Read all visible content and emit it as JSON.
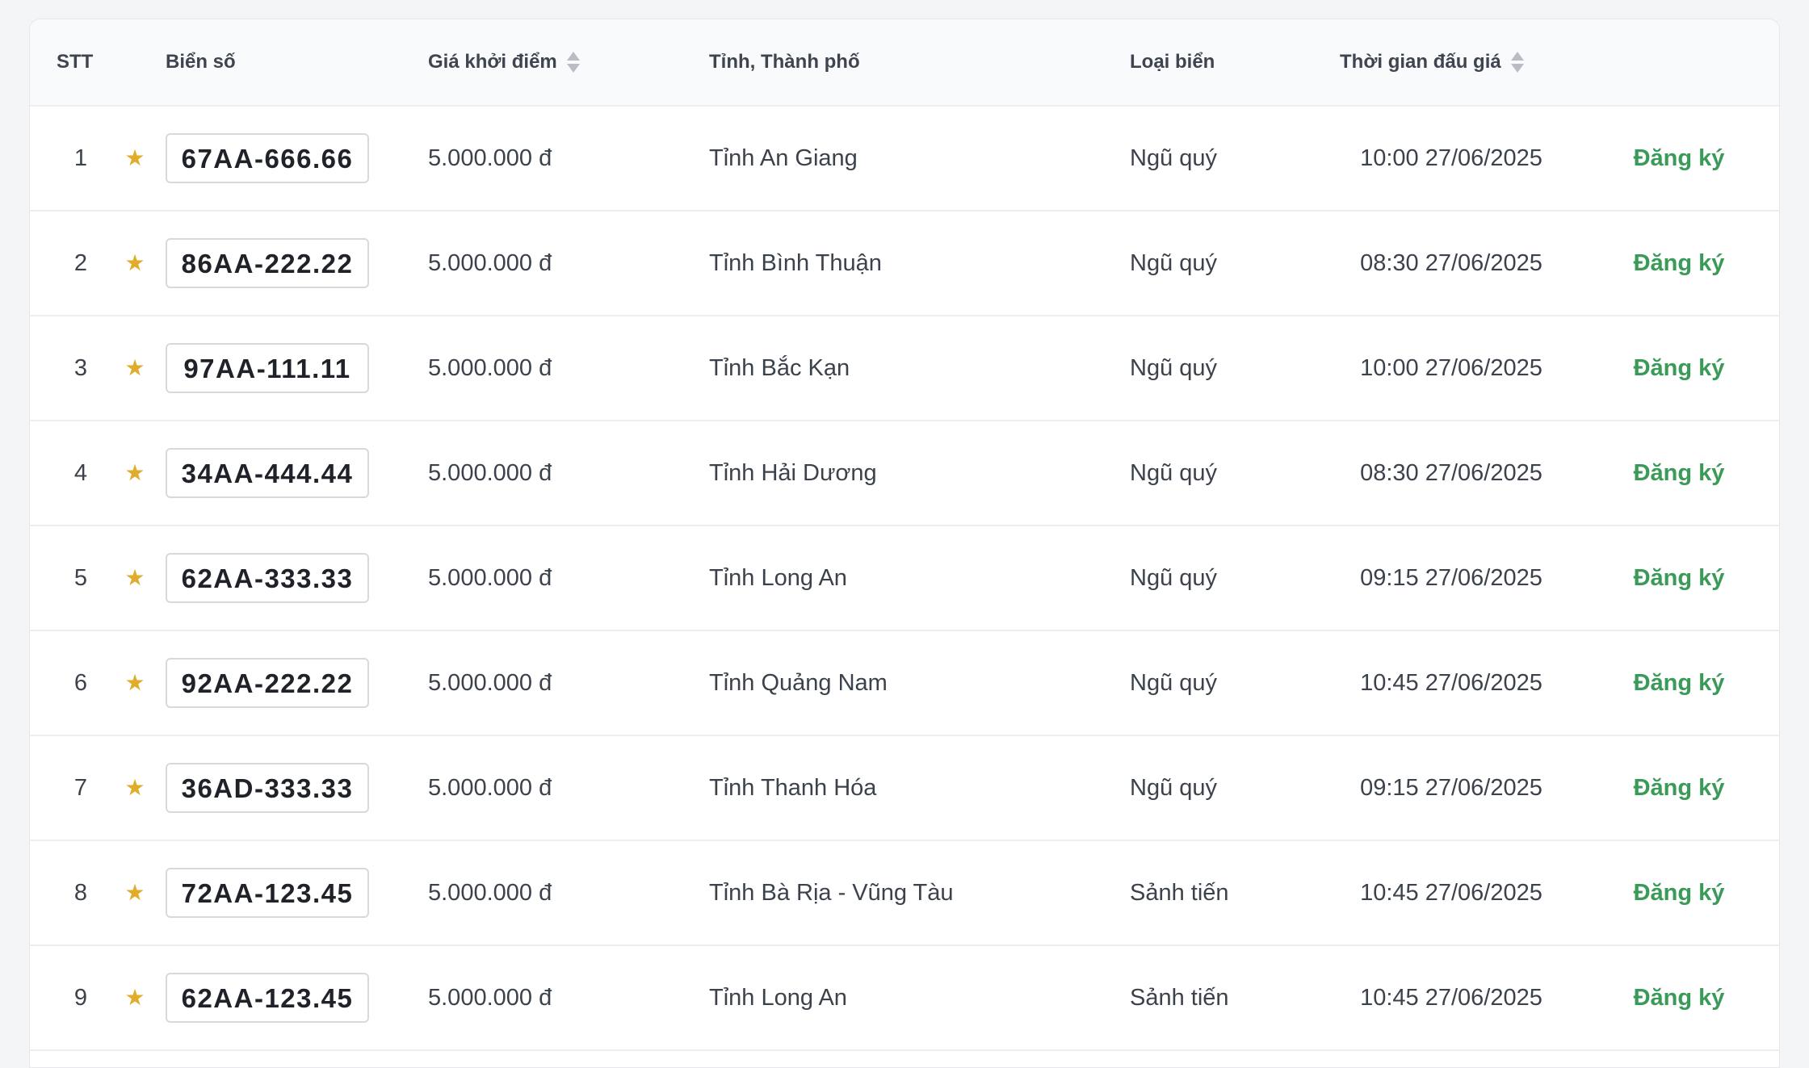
{
  "table": {
    "headers": {
      "stt": "STT",
      "plate": "Biển số",
      "price": "Giá khởi điểm",
      "province": "Tỉnh, Thành phố",
      "type": "Loại biển",
      "time": "Thời gian đấu giá"
    },
    "action_label": "Đăng ký",
    "rows": [
      {
        "stt": "1",
        "plate": "67AA-666.66",
        "price": "5.000.000 đ",
        "province": "Tỉnh An Giang",
        "type": "Ngũ quý",
        "time": "10:00 27/06/2025"
      },
      {
        "stt": "2",
        "plate": "86AA-222.22",
        "price": "5.000.000 đ",
        "province": "Tỉnh Bình Thuận",
        "type": "Ngũ quý",
        "time": "08:30 27/06/2025"
      },
      {
        "stt": "3",
        "plate": "97AA-111.11",
        "price": "5.000.000 đ",
        "province": "Tỉnh Bắc Kạn",
        "type": "Ngũ quý",
        "time": "10:00 27/06/2025"
      },
      {
        "stt": "4",
        "plate": "34AA-444.44",
        "price": "5.000.000 đ",
        "province": "Tỉnh Hải Dương",
        "type": "Ngũ quý",
        "time": "08:30 27/06/2025"
      },
      {
        "stt": "5",
        "plate": "62AA-333.33",
        "price": "5.000.000 đ",
        "province": "Tỉnh Long An",
        "type": "Ngũ quý",
        "time": "09:15 27/06/2025"
      },
      {
        "stt": "6",
        "plate": "92AA-222.22",
        "price": "5.000.000 đ",
        "province": "Tỉnh Quảng Nam",
        "type": "Ngũ quý",
        "time": "10:45 27/06/2025"
      },
      {
        "stt": "7",
        "plate": "36AD-333.33",
        "price": "5.000.000 đ",
        "province": "Tỉnh Thanh Hóa",
        "type": "Ngũ quý",
        "time": "09:15 27/06/2025"
      },
      {
        "stt": "8",
        "plate": "72AA-123.45",
        "price": "5.000.000 đ",
        "province": "Tỉnh Bà Rịa - Vũng Tàu",
        "type": "Sảnh tiến",
        "time": "10:45 27/06/2025"
      },
      {
        "stt": "9",
        "plate": "62AA-123.45",
        "price": "5.000.000 đ",
        "province": "Tỉnh Long An",
        "type": "Sảnh tiến",
        "time": "10:45 27/06/2025"
      }
    ]
  },
  "colors": {
    "accent_green": "#3a9a57",
    "star_gold": "#e0ac2b"
  },
  "icons": {
    "favorite": "star-icon",
    "sort": "sort-icon"
  }
}
